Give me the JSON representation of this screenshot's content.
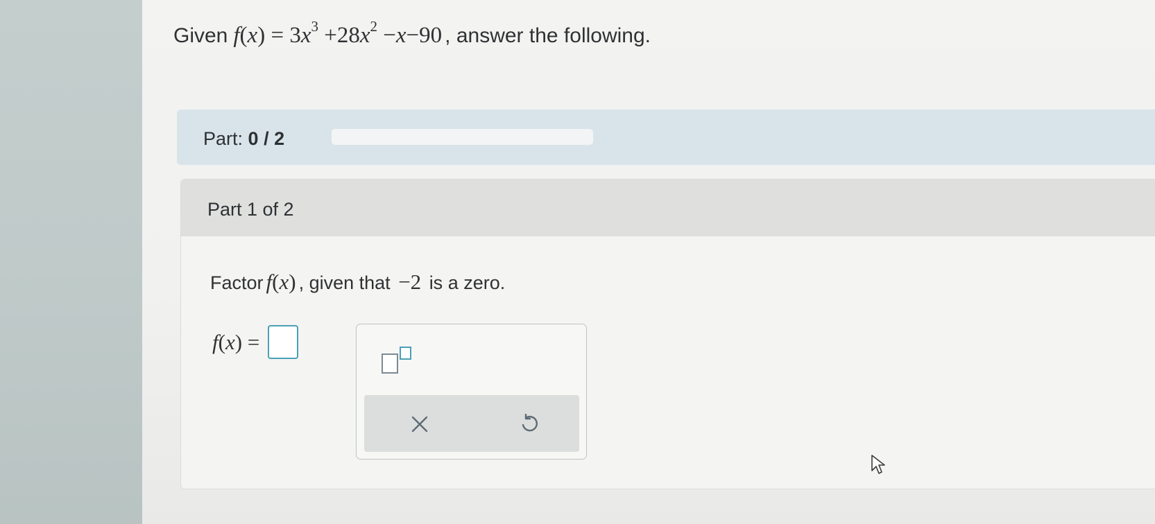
{
  "question": {
    "prefix": "Given",
    "function_name": "f",
    "variable": "x",
    "equals": "=",
    "term1_coef": "3",
    "term1_exp": "3",
    "term2_coef": "+28",
    "term2_exp": "2",
    "term3": "−",
    "term4": "−90",
    "suffix": ", answer the following."
  },
  "progress": {
    "label": "Part:",
    "current": "0",
    "separator": "/",
    "total": "2",
    "fraction": 0.0
  },
  "part": {
    "title": "Part 1 of 2",
    "instruction_prefix": "Factor",
    "instruction_middle": ", given that",
    "zero_value": "−2",
    "instruction_suffix": "is a zero."
  },
  "answer": {
    "lhs": "f",
    "var": "x",
    "equals": "=",
    "value": ""
  },
  "toolbox": {
    "exponent_icon": "exponent-template-icon",
    "clear_icon": "close-icon",
    "undo_icon": "undo-icon"
  },
  "colors": {
    "accent": "#4aa0b5",
    "progress_bar_bg": "#d9e4ea",
    "header_bg": "#dfe0de"
  }
}
